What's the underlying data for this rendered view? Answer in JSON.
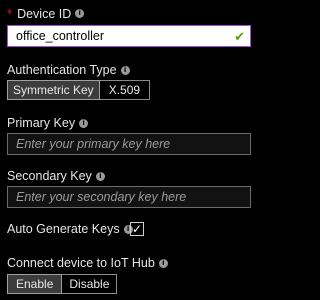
{
  "device_id": {
    "label": "Device ID",
    "value": "office_controller"
  },
  "auth": {
    "label": "Authentication Type",
    "options": [
      "Symmetric Key",
      "X.509"
    ],
    "selected": "Symmetric Key"
  },
  "primary_key": {
    "label": "Primary Key",
    "placeholder": "Enter your primary key here"
  },
  "secondary_key": {
    "label": "Secondary Key",
    "placeholder": "Enter your secondary key here"
  },
  "auto_generate": {
    "label": "Auto Generate Keys",
    "checked": true
  },
  "connect": {
    "label": "Connect device to IoT Hub",
    "options": [
      "Enable",
      "Disable"
    ],
    "selected": "Enable"
  },
  "colors": {
    "focus_border": "#a54fd0",
    "required": "#e81123",
    "valid": "#57a300"
  }
}
